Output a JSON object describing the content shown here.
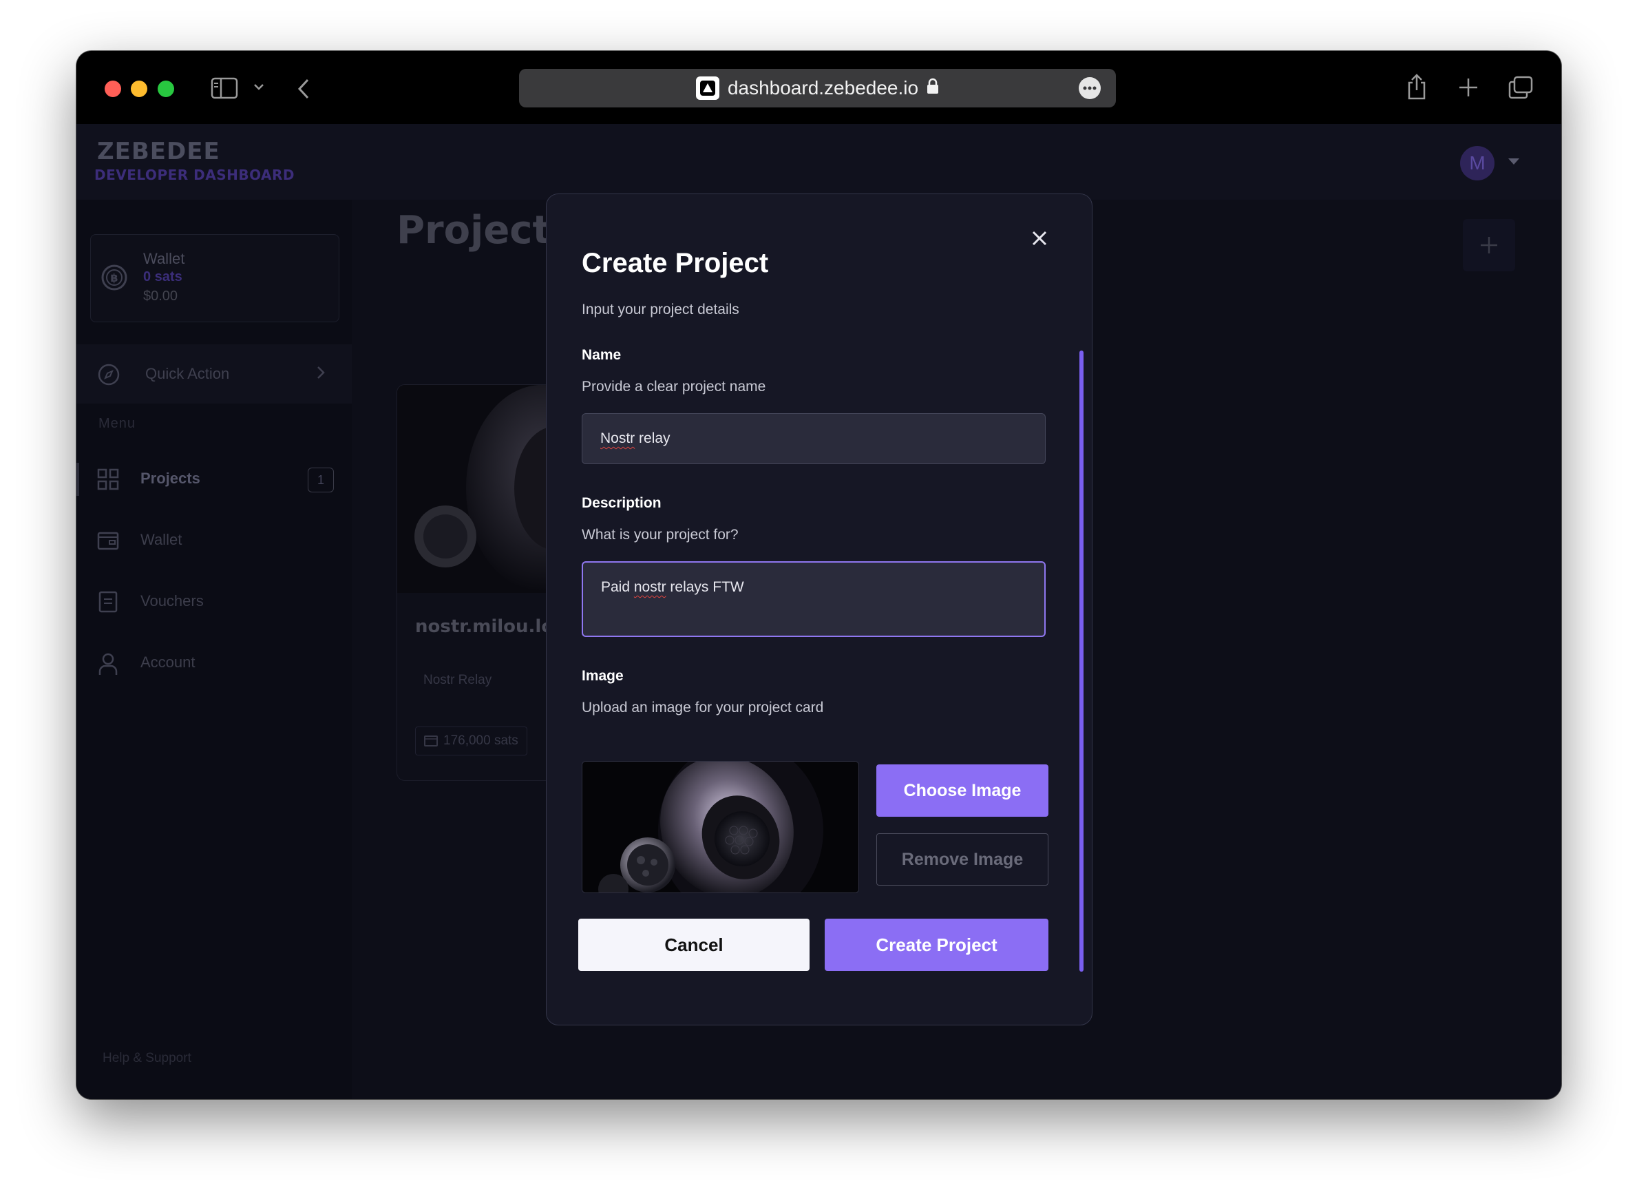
{
  "browser": {
    "url": "dashboard.zebedee.io"
  },
  "brand": {
    "name": "ZEBEDEE",
    "subtitle": "DEVELOPER DASHBOARD"
  },
  "user": {
    "avatar_initial": "M"
  },
  "sidebar": {
    "wallet": {
      "title": "Wallet",
      "sats": "0 sats",
      "usd": "$0.00"
    },
    "quick_action": "Quick Action",
    "menu_label": "Menu",
    "items": [
      {
        "label": "Projects",
        "badge": "1",
        "icon": "grid-icon"
      },
      {
        "label": "Wallet",
        "icon": "wallet-icon"
      },
      {
        "label": "Vouchers",
        "icon": "voucher-icon"
      },
      {
        "label": "Account",
        "icon": "person-icon"
      }
    ],
    "help": "Help & Support"
  },
  "main": {
    "title": "Projects",
    "project_card": {
      "name": "nostr.milou.lol",
      "type": "Nostr Relay",
      "balance": "176,000 sats"
    }
  },
  "modal": {
    "title": "Create Project",
    "subtitle": "Input your project details",
    "name_label": "Name",
    "name_help": "Provide a clear project name",
    "name_value_word1": "Nostr",
    "name_value_rest": " relay",
    "description_label": "Description",
    "description_help": "What is your project for?",
    "description_value_pre": "Paid ",
    "description_value_word": "nostr",
    "description_value_post": " relays FTW",
    "image_label": "Image",
    "image_help": "Upload an image for your project card",
    "choose_image": "Choose Image",
    "remove_image": "Remove Image",
    "cancel": "Cancel",
    "create": "Create Project"
  },
  "colors": {
    "accent": "#8b6ef4",
    "background": "#0d0e18",
    "modal": "#161725"
  }
}
